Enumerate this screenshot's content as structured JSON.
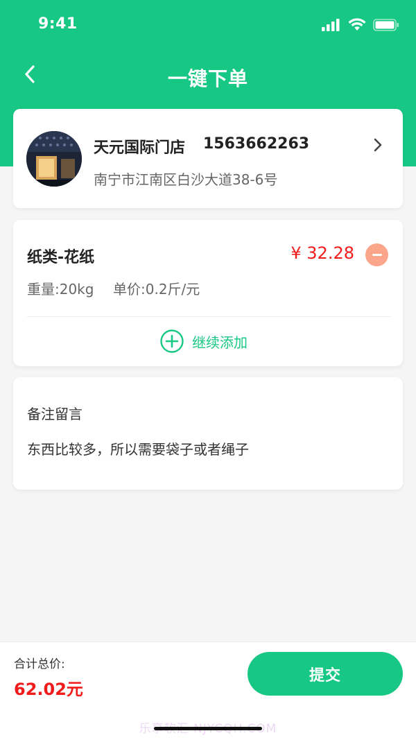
{
  "status_bar": {
    "time": "9:41",
    "icons": [
      "signal-icon",
      "wifi-icon",
      "battery-icon"
    ]
  },
  "nav": {
    "title": "一键下单",
    "back_icon": "chevron-left-icon"
  },
  "store": {
    "name": "天元国际门店",
    "phone": "1563662263",
    "address": "南宁市江南区白沙大道38-6号",
    "chevron_icon": "chevron-right-icon"
  },
  "item": {
    "name": "纸类-花纸",
    "price": "¥ 32.28",
    "weight": "重量:20kg",
    "unit_price": "单价:0.2斤/元",
    "remove_icon": "minus-circle-icon",
    "add_label": "继续添加",
    "add_icon": "plus-circle-icon"
  },
  "note": {
    "title": "备注留言",
    "text": "东西比较多，所以需要袋子或者绳子"
  },
  "footer": {
    "total_label": "合计总价:",
    "total_value": "62.02元",
    "submit_label": "提交"
  },
  "watermark": "乐享软汇 NJYCQH.COM",
  "colors": {
    "brand_green": "#17c784",
    "price_red": "#f11b1b",
    "minus_orange": "#fba68a",
    "background": "#f5f5f5"
  }
}
